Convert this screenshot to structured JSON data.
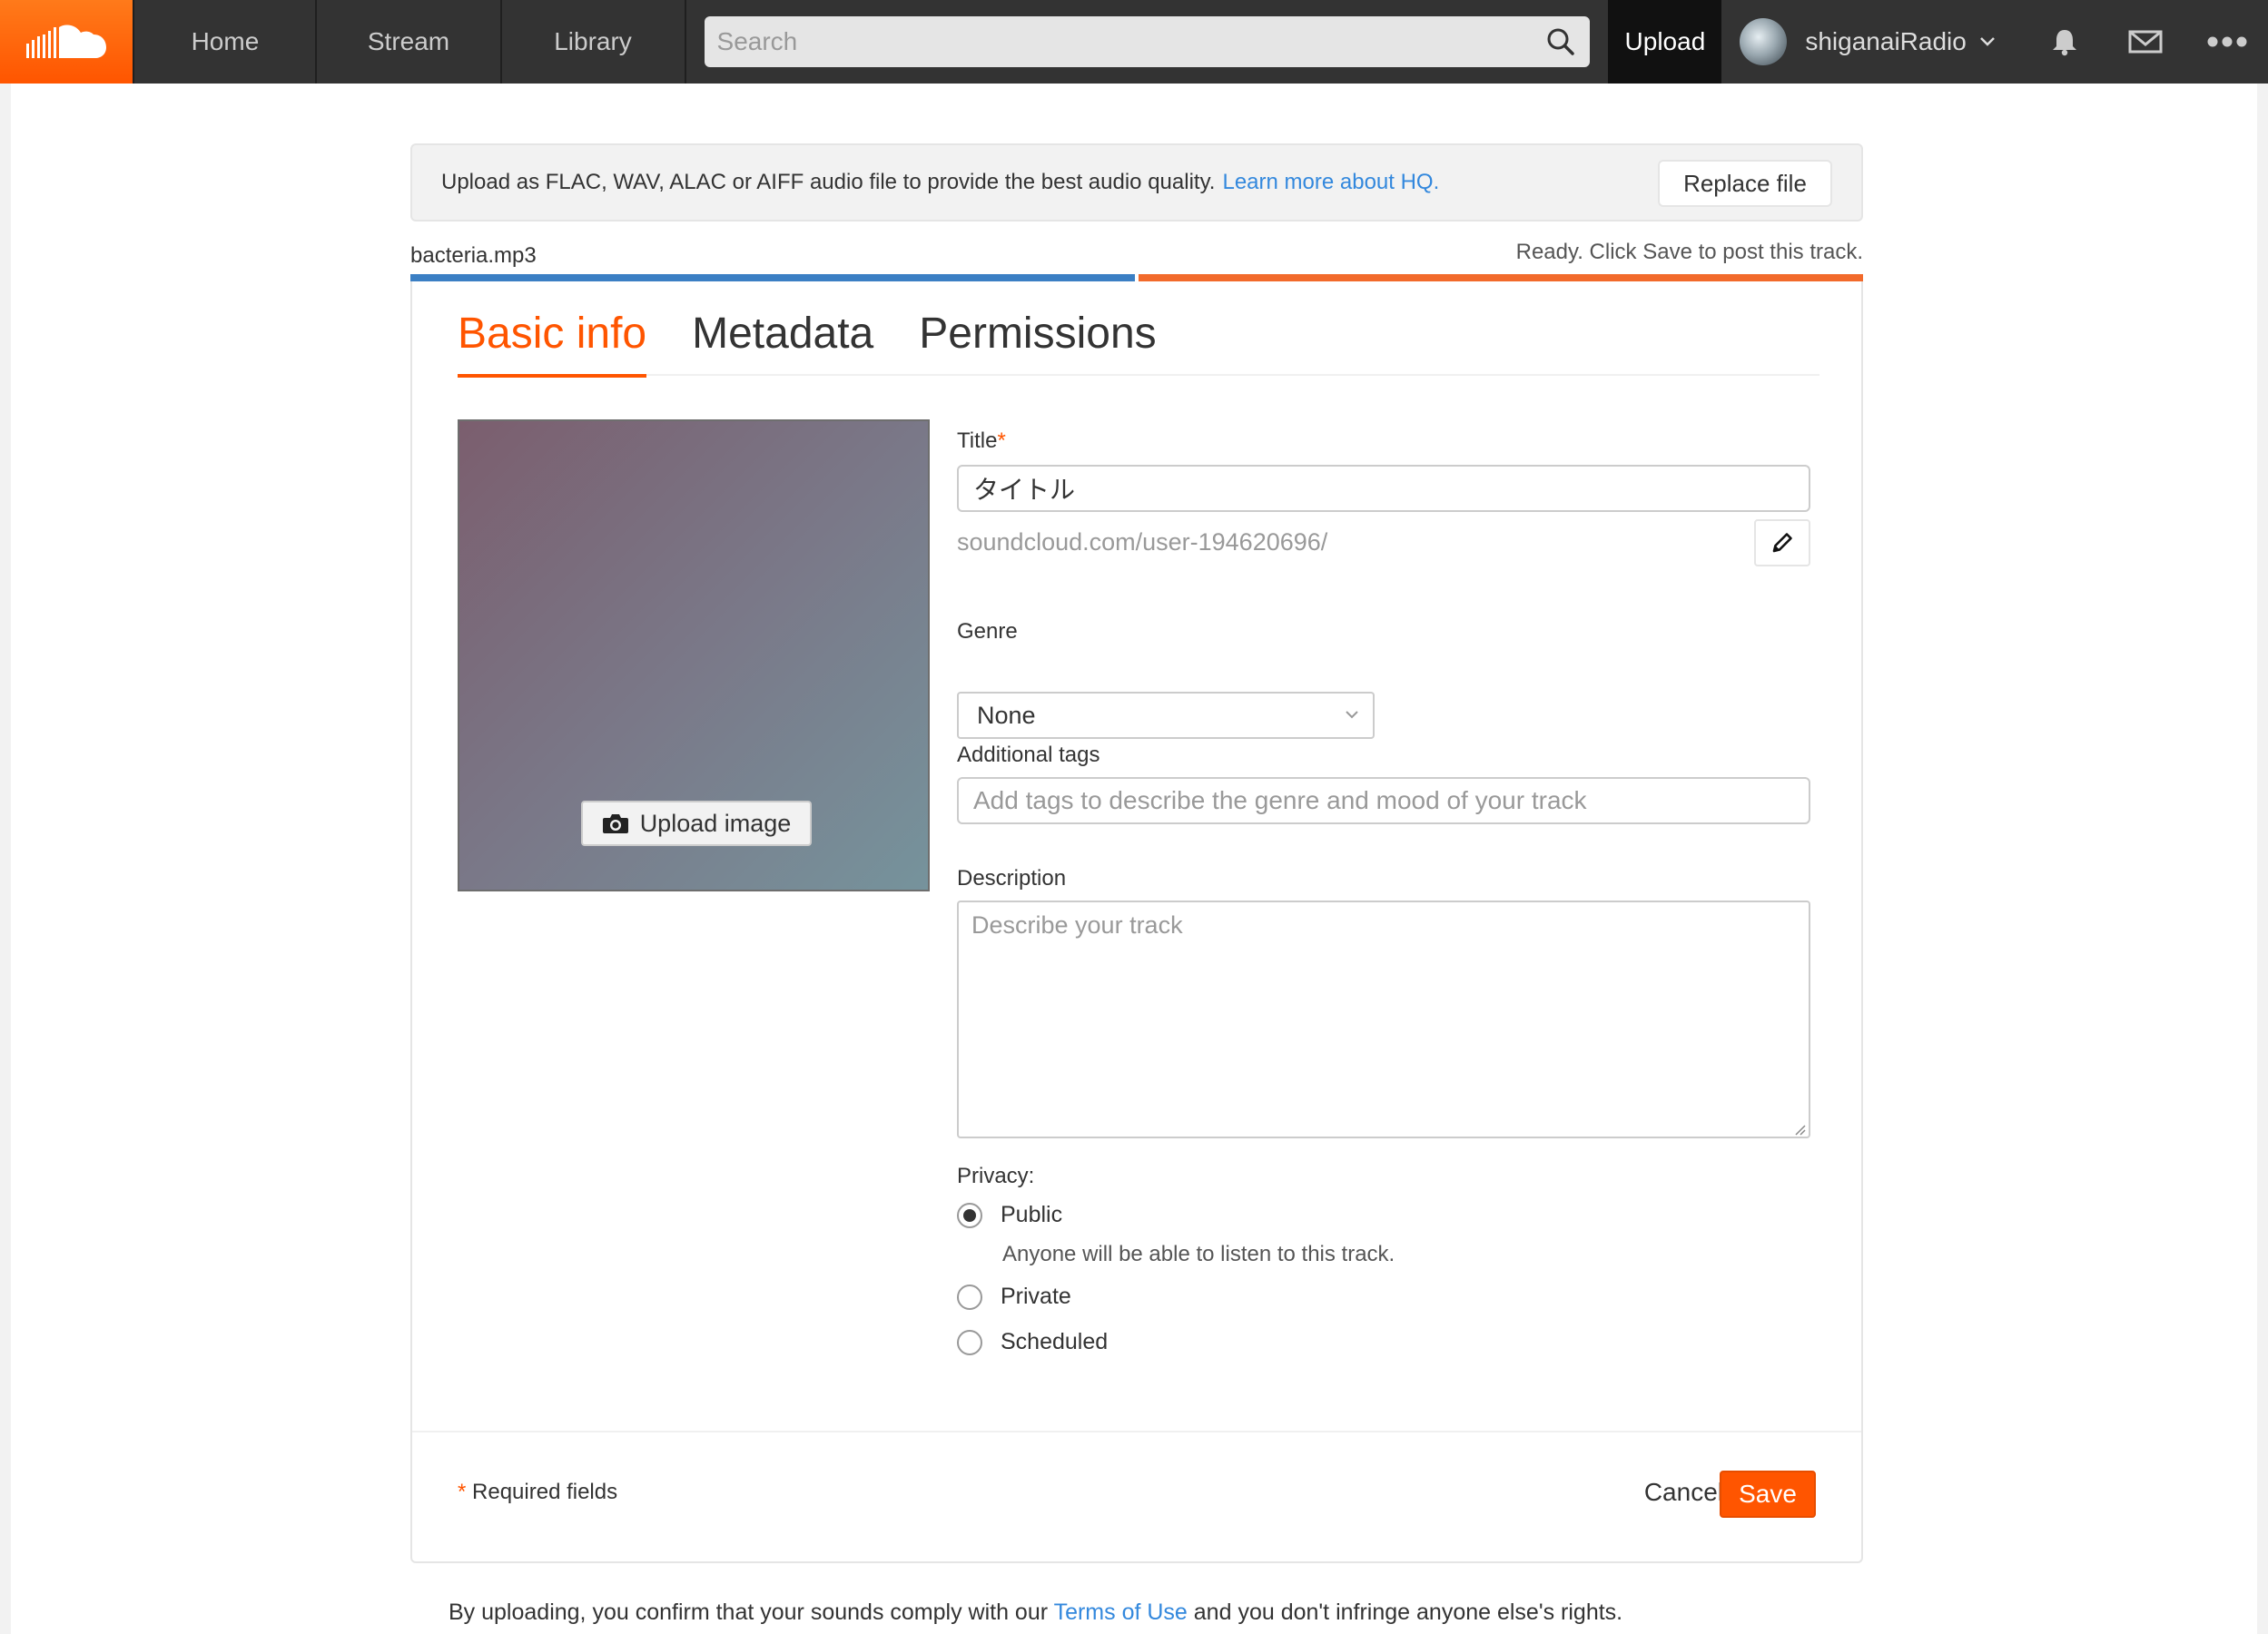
{
  "nav": {
    "home": "Home",
    "stream": "Stream",
    "library": "Library",
    "search_placeholder": "Search",
    "upload": "Upload",
    "username": "shiganaiRadio",
    "icons": [
      "soundcloud-logo-icon",
      "search-icon",
      "chevron-down-icon",
      "bell-icon",
      "mail-icon",
      "more-icon"
    ]
  },
  "banner": {
    "text": "Upload as FLAC, WAV, ALAC or AIFF audio file to provide the best audio quality.",
    "link": "Learn more about HQ.",
    "replace": "Replace file"
  },
  "file": {
    "name": "bacteria.mp3",
    "status": "Ready. Click Save to post this track.",
    "progress": 1.0
  },
  "tabs": [
    "Basic info",
    "Metadata",
    "Permissions"
  ],
  "artwork": {
    "upload_label": "Upload image"
  },
  "form": {
    "title_label": "Title",
    "required_mark": "*",
    "title_value": "タイトル",
    "url": "soundcloud.com/user-194620696/",
    "genre_label": "Genre",
    "genre_value": "None",
    "tags_label": "Additional tags",
    "tags_placeholder": "Add tags to describe the genre and mood of your track",
    "description_label": "Description",
    "description_placeholder": "Describe your track",
    "privacy_label": "Privacy:",
    "privacy_options": [
      {
        "label": "Public",
        "desc": "Anyone will be able to listen to this track.",
        "checked": true
      },
      {
        "label": "Private",
        "checked": false
      },
      {
        "label": "Scheduled",
        "checked": false
      }
    ]
  },
  "footer": {
    "required_note": "Required fields",
    "cancel": "Cancel",
    "save": "Save",
    "terms_pre": "By uploading, you confirm that your sounds comply with our",
    "terms_link": "Terms of Use",
    "terms_post": "and you don't infringe anyone else's rights."
  },
  "colors": {
    "accent": "#ff5500",
    "link": "#3388dd",
    "nav_bg": "#333333",
    "progress_blue": "#3b7fc4",
    "progress_orange": "#f26a2b"
  }
}
